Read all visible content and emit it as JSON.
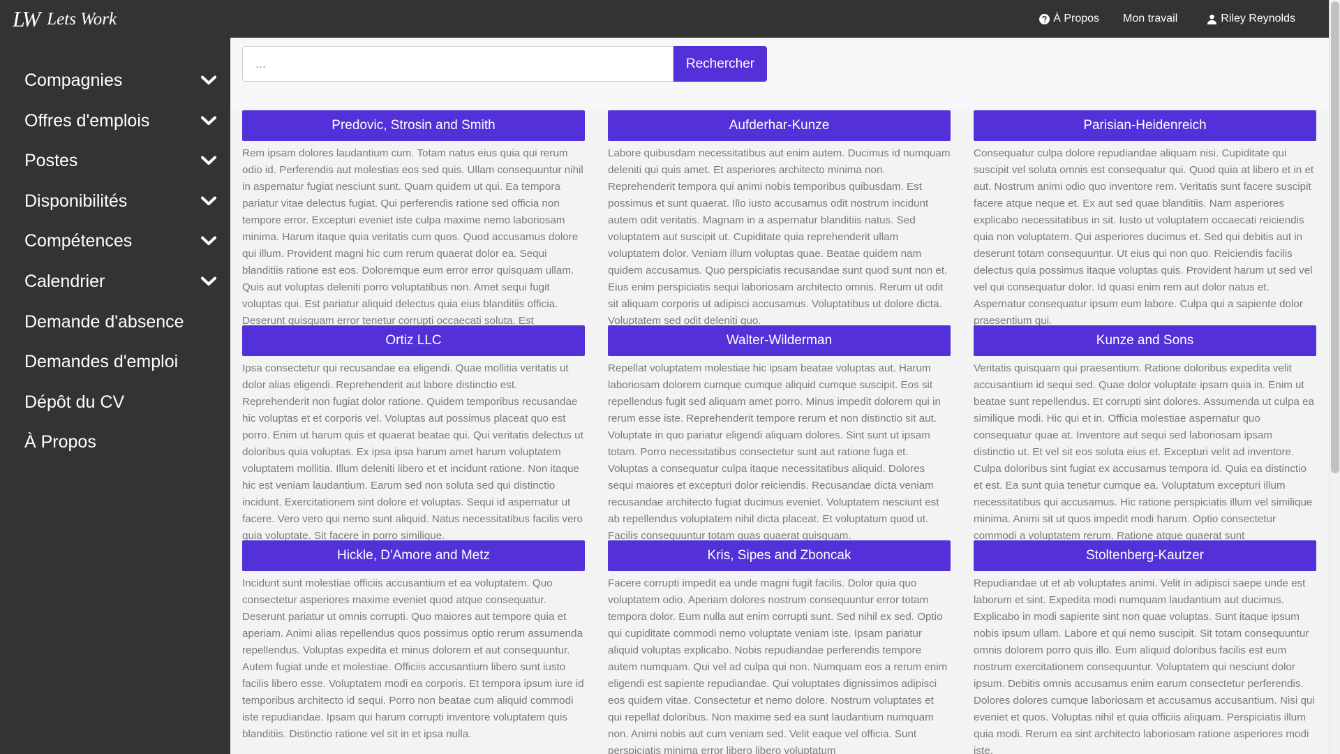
{
  "brand": {
    "mark": "LW",
    "name": "Lets Work"
  },
  "topnav": {
    "about": "À Propos",
    "my_work": "Mon travail",
    "user": "Riley Reynolds"
  },
  "sidebar": {
    "items": [
      {
        "label": "Compagnies",
        "has_dropdown": true
      },
      {
        "label": "Offres d'emplois",
        "has_dropdown": true
      },
      {
        "label": "Postes",
        "has_dropdown": true
      },
      {
        "label": "Disponibilités",
        "has_dropdown": true
      },
      {
        "label": "Compétences",
        "has_dropdown": true
      },
      {
        "label": "Calendrier",
        "has_dropdown": true
      },
      {
        "label": "Demande d'absence",
        "has_dropdown": false
      },
      {
        "label": "Demandes d'emploi",
        "has_dropdown": false
      },
      {
        "label": "Dépôt du CV",
        "has_dropdown": false
      },
      {
        "label": "À Propos",
        "has_dropdown": false
      }
    ]
  },
  "search": {
    "placeholder": "...",
    "button_label": "Rechercher"
  },
  "companies": [
    {
      "name": "Predovic, Strosin and Smith",
      "description": "Rem ipsam dolores laudantium cum. Totam natus eius quia qui rerum odio id. Perferendis aut molestias eos sed quis. Ullam consequuntur nihil in aspernatur fugiat nesciunt sunt. Quam quidem ut qui. Ea tempora pariatur vitae delectus fugiat. Qui perferendis ratione sed officia non tempore error. Excepturi eveniet iste culpa maxime nemo laboriosam minima. Harum itaque quia veritatis cum quos. Quod accusamus dolore qui illum. Provident magni hic cum rerum quaerat dolor ea. Sequi blanditiis ratione est eos. Doloremque eum error error quisquam ullam. Quis aut voluptas deleniti porro voluptatibus non. Amet sequi fugit voluptas qui. Est pariatur aliquid delectus quia eius blanditiis officia. Deserunt quisquam error tenetur corrupti occaecati soluta. Est"
    },
    {
      "name": "Aufderhar-Kunze",
      "description": "Labore quibusdam necessitatibus aut enim autem. Ducimus id numquam deleniti qui quis amet. Et asperiores architecto minima non. Reprehenderit tempora qui animi nobis temporibus quibusdam. Est possimus et sunt quaerat. Illo iusto accusamus odit nostrum incidunt autem odit veritatis. Magnam in a aspernatur blanditiis natus. Sed voluptatem aut suscipit ut. Cupiditate quia reprehenderit ullam voluptatem dolor. Veniam illum voluptas quae. Beatae quidem nam quidem accusamus. Quo perspiciatis recusandae sunt quod sunt non et. Eius enim perspiciatis sequi laboriosam architecto omnis. Rerum ut odit sit aliquam corporis ut adipisci accusamus. Voluptatibus ut dolore dicta. Voluptatem sed odit deleniti quo."
    },
    {
      "name": "Parisian-Heidenreich",
      "description": "Consequatur culpa dolore repudiandae aliquam nisi. Cupiditate qui suscipit vel soluta omnis est consequatur qui. Quod quia at libero et in et aut. Nostrum animi odio quo inventore rem. Veritatis sunt facere suscipit facere atque neque et. Ex aut sed quae blanditiis. Nam asperiores explicabo necessitatibus in sit. Iusto ut voluptatem occaecati reiciendis quia non voluptatem. Qui asperiores ducimus et. Sed qui debitis aut in deserunt totam consequuntur. Ut eius qui non quo. Reiciendis facilis delectus quia possimus itaque voluptas quis. Provident harum ut sed vel vel qui consequatur dolor. Id quasi enim rem aut dolor natus et. Aspernatur consequatur ipsum eum labore. Culpa qui a sapiente dolor praesentium qui."
    },
    {
      "name": "Ortiz LLC",
      "description": "Ipsa consectetur qui recusandae ea eligendi. Quae mollitia veritatis ut dolor alias eligendi. Reprehenderit aut labore distinctio est. Reprehenderit non fugiat dolor ratione. Quidem temporibus recusandae hic voluptas et et corporis vel. Voluptas aut possimus placeat quo est porro. Enim ut harum quis et quaerat beatae qui. Qui veritatis delectus ut doloribus quia voluptas. Ex ipsa ipsa harum amet harum voluptatem voluptatem mollitia. Illum deleniti libero et et incidunt ratione. Non itaque hic est veniam laudantium. Earum sed non soluta sed qui distinctio incidunt. Exercitationem sint dolore et voluptas. Sequi id aspernatur ut facere. Vero vero qui nemo sunt aliquid. Natus necessitatibus facilis vero quia voluptate. Sit facere in porro similique."
    },
    {
      "name": "Walter-Wilderman",
      "description": "Repellat voluptatem molestiae hic ipsam beatae voluptas aut. Harum laboriosam dolorem cumque cumque aliquid cumque suscipit. Eos sit repellendus fugit sed aliquam amet porro. Minus impedit dolorem qui in rerum esse iste. Reprehenderit tempore rerum et non distinctio sit aut. Voluptate in quo pariatur eligendi aliquam dolores. Sint sunt ut ipsam totam. Porro necessitatibus consectetur sunt aut ratione fuga et. Voluptas a consequatur culpa itaque necessitatibus aliquid. Dolores sequi maiores et excepturi dolor reiciendis. Recusandae dicta veniam recusandae architecto fugiat ducimus eveniet. Voluptatem nesciunt est ab repellendus voluptatem nihil dicta placeat. Et voluptatum quod ut. Facilis consequuntur totam quas quaerat quisquam."
    },
    {
      "name": "Kunze and Sons",
      "description": "Veritatis quisquam qui praesentium. Ratione doloribus expedita velit accusantium id sequi sed. Quae dolor voluptate ipsam quia in. Enim ut beatae sunt repellendus. Et corrupti sint dolores. Assumenda ut culpa ea similique modi. Hic qui et in. Officia molestiae aspernatur quo consequatur quae at. Inventore aut sequi sed laboriosam ipsam distinctio ut. Et vel sit eos soluta eius et. Excepturi velit ad inventore. Culpa doloribus sint fugiat ex accusamus tempora id. Quia ea distinctio et est. Ea sunt quia tenetur cumque ea. Voluptatum excepturi illum necessitatibus qui accusamus. Hic ratione perspiciatis illum vel similique minima. Animi sit ut quos impedit modi harum. Optio consectetur commodi a voluptatem rerum. Ratione atque quaerat sunt"
    },
    {
      "name": "Hickle, D'Amore and Metz",
      "description": "Incidunt sunt molestiae officiis accusantium et ea voluptatem. Quo consectetur asperiores maxime eveniet quod atque consequatur. Deserunt pariatur ut omnis corrupti. Quo maiores aut tempore quia et aperiam. Animi alias repellendus quos possimus optio rerum assumenda repellendus. Voluptas expedita et minus dolorem et aut consequuntur. Autem fugiat unde et molestiae. Officiis accusantium libero sunt iusto facilis libero esse. Voluptatem modi ea corporis. Et tempora ipsum iure id temporibus architecto id sequi. Porro non beatae cum aliquid commodi iste repudiandae. Ipsam qui harum corrupti inventore voluptatem quis blanditiis. Distinctio ratione vel sit in et ipsa nulla."
    },
    {
      "name": "Kris, Sipes and Zboncak",
      "description": "Facere corrupti impedit ea unde magni fugit facilis. Dolor quia quo voluptatem odio. Aperiam dolores nostrum consequuntur error totam tempora dolor. Eum nulla aut enim corrupti sunt. Sed nihil ex sed. Optio qui cupiditate commodi nemo voluptate veniam iste. Ipsam pariatur aliquid voluptas explicabo. Nobis repudiandae perferendis tempore autem numquam. Qui vel ad culpa qui non. Numquam eos a rerum enim eligendi est sapiente repudiandae. Qui voluptates dignissimos adipisci eos quidem vitae. Consectetur et nemo dolore. Nostrum voluptates et qui repellat doloribus. Non maxime sed ea sunt laudantium numquam non. Animi nobis aut cum veniam sed. Velit eaque vel officia. Sunt perspiciatis minima error libero libero voluptatum"
    },
    {
      "name": "Stoltenberg-Kautzer",
      "description": "Repudiandae ut et ab voluptates animi. Velit in adipisci saepe unde est laborum et sint. Expedita modi numquam laudantium aut ducimus. Explicabo in modi sapiente sint non quae voluptas. Sunt itaque ipsum nobis ipsum ullam. Labore et qui nemo suscipit. Sit totam consequuntur omnis dolorem porro quis illo. Eum aliquid doloribus facilis est eum nostrum exercitationem consequuntur. Voluptatem qui nesciunt dolor ipsum. Debitis omnis accusamus enim earum consectetur perferendis. Dolores dolores cumque laboriosam et accusamus accusantium. Nisi qui eveniet et quos. Voluptas nihil et quia officiis aliquam. Perspiciatis illum quia modi. Rerum ea sint architecto laboriosam ratione asperiores modi iste."
    }
  ],
  "colors": {
    "dark": "#333333",
    "accent": "#5330d8",
    "background": "#f3f3f3",
    "body_text": "#7a7a7a"
  }
}
